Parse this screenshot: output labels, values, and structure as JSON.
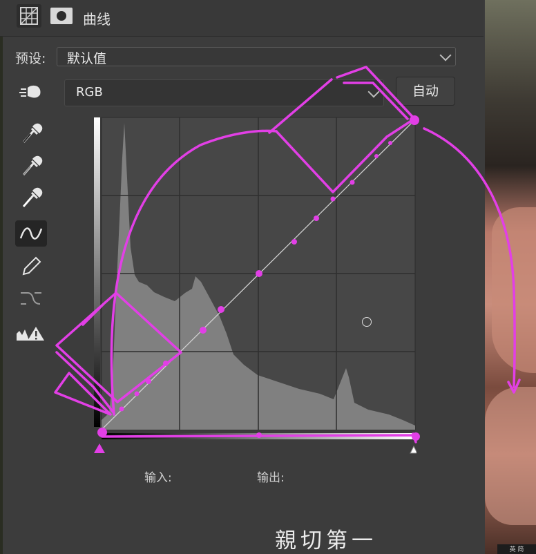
{
  "panel": {
    "title": "曲线",
    "preset": {
      "label": "预设:",
      "value": "默认值"
    },
    "channel": {
      "value": "RGB"
    },
    "auto_button": "自动",
    "input_label": "输入:",
    "output_label": "输出:"
  },
  "tools": [
    {
      "name": "target-adjust-hand-icon"
    },
    {
      "name": "black-point-eyedropper-icon"
    },
    {
      "name": "gray-point-eyedropper-icon"
    },
    {
      "name": "white-point-eyedropper-icon"
    },
    {
      "name": "curve-point-tool-icon",
      "selected": true
    },
    {
      "name": "pencil-icon"
    },
    {
      "name": "smooth-curve-icon"
    },
    {
      "name": "clipping-warning-icon"
    }
  ],
  "subtitle": "親切第一",
  "taskbar": "英 简",
  "colors": {
    "annotation": "#e23fe6",
    "panel": "#3c3c3c",
    "graph": "#474747",
    "histogram": "#808080"
  }
}
